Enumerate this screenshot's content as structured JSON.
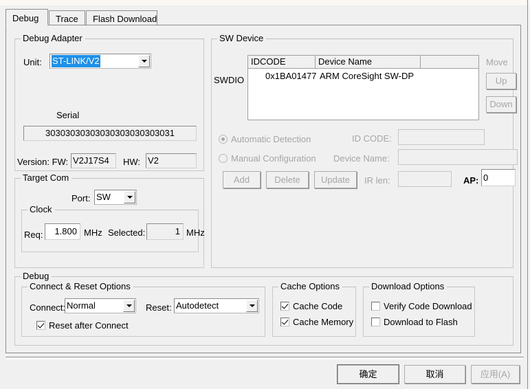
{
  "dialog": {
    "tabs": [
      {
        "label": "Debug",
        "active": true
      },
      {
        "label": "Trace",
        "active": false
      },
      {
        "label": "Flash Download",
        "active": false
      }
    ]
  },
  "debug_adapter": {
    "legend": "Debug Adapter",
    "unit_label": "Unit:",
    "unit_value": "ST-LINK/V2",
    "unit_selected": true,
    "serial_label": "Serial",
    "serial_value": "30303030303030303030303031",
    "version_label": "Version: FW:",
    "fw_value": "V2J17S4",
    "hw_label": "HW:",
    "hw_value": "V2"
  },
  "target_com": {
    "legend": "Target Com",
    "port_label": "Port:",
    "port_value": "SW",
    "clock": {
      "legend": "Clock",
      "req_label": "Req:",
      "req_value": "1.800",
      "req_unit": "MHz",
      "selected_label": "Selected:",
      "selected_value": "1",
      "selected_unit": "MHz"
    }
  },
  "sw_device": {
    "legend": "SW Device",
    "port_name": "SWDIO",
    "columns": [
      "IDCODE",
      "Device Name",
      ""
    ],
    "rows": [
      {
        "idcode": "0x1BA01477",
        "device_name": "ARM CoreSight SW-DP"
      }
    ],
    "move_label": "Move",
    "up_label": "Up",
    "down_label": "Down",
    "automatic_detection_label": "Automatic Detection",
    "manual_configuration_label": "Manual Configuration",
    "detection_mode": "automatic",
    "id_code_label": "ID CODE:",
    "id_code_value": "",
    "device_name_label": "Device Name:",
    "device_name_value": "",
    "ir_len_label": "IR len:",
    "ir_len_value": "",
    "ap_label": "AP:",
    "ap_value": "0",
    "add_label": "Add",
    "delete_label": "Delete",
    "update_label": "Update"
  },
  "debug_group": {
    "legend": "Debug",
    "connect_reset": {
      "legend": "Connect & Reset Options",
      "connect_label": "Connect:",
      "connect_value": "Normal",
      "reset_label": "Reset:",
      "reset_value": "Autodetect",
      "reset_after_connect_label": "Reset after Connect",
      "reset_after_connect_checked": true
    },
    "cache_options": {
      "legend": "Cache Options",
      "cache_code_label": "Cache Code",
      "cache_code_checked": true,
      "cache_memory_label": "Cache Memory",
      "cache_memory_checked": true
    },
    "download_options": {
      "legend": "Download Options",
      "verify_code_download_label": "Verify Code Download",
      "verify_code_download_checked": false,
      "download_to_flash_label": "Download to Flash",
      "download_to_flash_checked": false
    }
  },
  "footer": {
    "ok_label": "确定",
    "cancel_label": "取消",
    "apply_label": "应用(A)"
  },
  "colors": {
    "selection_blue": "#1e90e8",
    "dialog_bg": "#f0f0f0",
    "field_bg": "#ffffff",
    "disabled_text": "#a6a6a6",
    "border": "#8d8d8d"
  }
}
